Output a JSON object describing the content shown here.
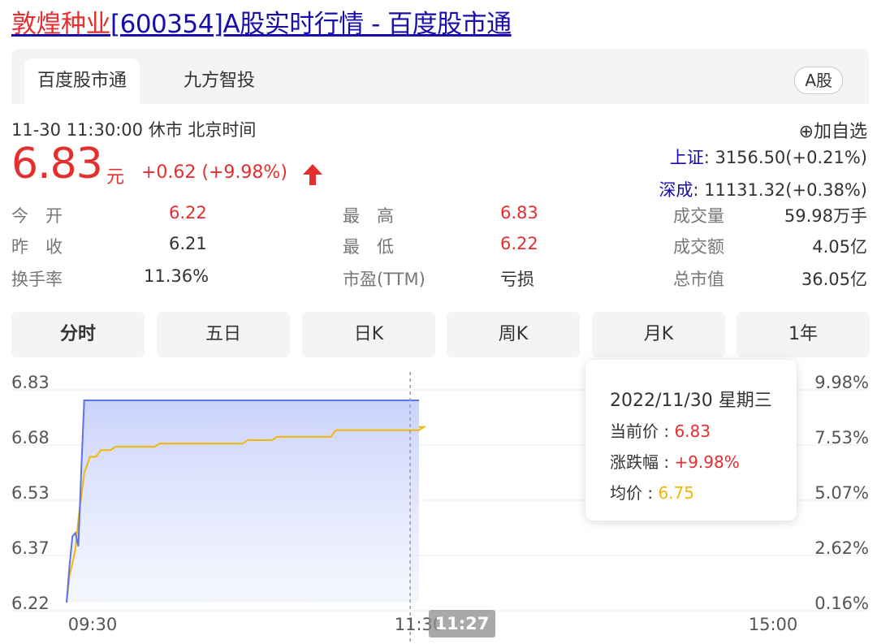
{
  "title": {
    "highlight": "敦煌种业",
    "rest": "[600354]A股实时行情 - 百度股市通"
  },
  "tabs": [
    {
      "label": "百度股市通"
    },
    {
      "label": "九方智投"
    }
  ],
  "market_badge": "A股",
  "quote": {
    "timestamp": "11-30 11:30:00",
    "status": "休市",
    "timezone": "北京时间",
    "price": "6.83",
    "unit": "元",
    "change": "+0.62 (+9.98%)",
    "add_watchlist": "⊕加自选",
    "indices": [
      {
        "name": "上证",
        "value": ": 3156.50(+0.21%)"
      },
      {
        "name": "深成",
        "value": ": 11131.32(+0.38%)"
      }
    ]
  },
  "stats": {
    "open_label": "今　开",
    "open": "6.22",
    "prev_close_label": "昨　收",
    "prev_close": "6.21",
    "turnover_label": "换手率",
    "turnover": "11.36%",
    "high_label": "最　高",
    "high": "6.83",
    "low_label": "最　低",
    "low": "6.22",
    "pe_label": "市盈(TTM)",
    "pe": "亏损",
    "volume_label": "成交量",
    "volume": "59.98万手",
    "amount_label": "成交额",
    "amount": "4.05亿",
    "mktcap_label": "总市值",
    "mktcap": "36.05亿"
  },
  "period_tabs": [
    "分时",
    "五日",
    "日K",
    "周K",
    "月K",
    "1年"
  ],
  "colors": {
    "up": "#e52e2e",
    "price_line": "#5b73e8",
    "avg_line": "#f2b705",
    "link": "#1a0dab"
  },
  "chart_data": {
    "type": "line",
    "y_left_ticks": [
      "6.83",
      "6.68",
      "6.53",
      "6.37",
      "6.22"
    ],
    "y_right_ticks": [
      "9.98%",
      "7.53%",
      "5.07%",
      "2.62%",
      "0.16%"
    ],
    "x_ticks": [
      "09:30",
      "11:30",
      "15:00"
    ],
    "ylim": [
      6.22,
      6.83
    ],
    "crosshair_time": "11:27",
    "series": [
      {
        "name": "当前价",
        "x": [
          "09:30",
          "09:31",
          "09:32",
          "09:33",
          "09:34",
          "09:35",
          "09:36",
          "09:37",
          "11:30"
        ],
        "values": [
          6.22,
          6.33,
          6.42,
          6.43,
          6.39,
          6.62,
          6.83,
          6.83,
          6.83
        ]
      },
      {
        "name": "均价",
        "x": [
          "09:30",
          "09:31",
          "09:33",
          "09:34",
          "09:36",
          "09:38",
          "09:40",
          "09:45",
          "10:00",
          "10:30",
          "10:40",
          "11:00",
          "11:30"
        ],
        "values": [
          6.22,
          6.3,
          6.38,
          6.47,
          6.61,
          6.66,
          6.68,
          6.69,
          6.7,
          6.71,
          6.72,
          6.74,
          6.75
        ]
      }
    ]
  },
  "tooltip": {
    "date": "2022/11/30 星期三",
    "price_label": "当前价 : ",
    "price": "6.83",
    "change_label": "涨跌幅 : ",
    "change": "+9.98%",
    "avg_label": "均价 : ",
    "avg": "6.75"
  }
}
